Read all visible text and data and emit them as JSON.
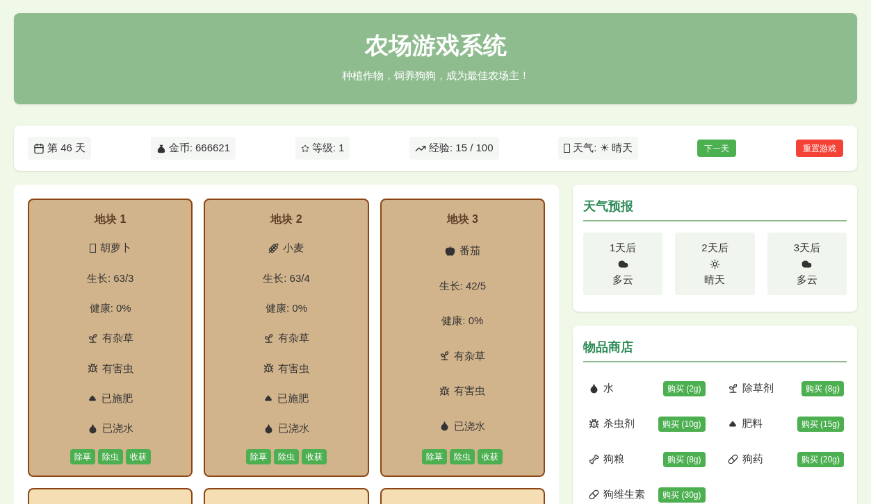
{
  "header": {
    "title": "农场游戏系统",
    "subtitle": "种植作物，饲养狗狗，成为最佳农场主！"
  },
  "stats": [
    {
      "kind": "calendar",
      "text": "第 46 天"
    },
    {
      "kind": "money",
      "text": "金币: 666621"
    },
    {
      "kind": "star",
      "text": "等级: 1"
    },
    {
      "kind": "chart",
      "text": "经验: 15 / 100"
    },
    {
      "kind": "missing",
      "text": "天气: ☀ 晴天"
    }
  ],
  "actions": [
    {
      "kind": "primary",
      "label": "下一天"
    },
    {
      "kind": "danger",
      "label": "重置游戏"
    }
  ],
  "plots": [
    {
      "title": "地块 1",
      "kind": "missing",
      "crop": "胡萝卜",
      "growth": "生长: 63/3",
      "health": "健康: 0%",
      "statuses": [
        {
          "kind": "weed",
          "text": "有杂草"
        },
        {
          "kind": "pest",
          "text": "有害虫"
        },
        {
          "kind": "fertilizer",
          "text": "已施肥"
        },
        {
          "kind": "water",
          "text": "已浇水"
        }
      ],
      "buttons": [
        "除草",
        "除虫",
        "收获"
      ]
    },
    {
      "title": "地块 2",
      "kind": "wheat",
      "crop": "小麦",
      "growth": "生长: 63/4",
      "health": "健康: 0%",
      "statuses": [
        {
          "kind": "weed",
          "text": "有杂草"
        },
        {
          "kind": "pest",
          "text": "有害虫"
        },
        {
          "kind": "fertilizer",
          "text": "已施肥"
        },
        {
          "kind": "water",
          "text": "已浇水"
        }
      ],
      "buttons": [
        "除草",
        "除虫",
        "收获"
      ]
    },
    {
      "title": "地块 3",
      "kind": "tomato",
      "crop": "番茄",
      "growth": "生长: 42/5",
      "health": "健康: 0%",
      "statuses": [
        {
          "kind": "weed",
          "text": "有杂草"
        },
        {
          "kind": "pest",
          "text": "有害虫"
        },
        {
          "kind": "water",
          "text": "已浇水"
        }
      ],
      "buttons": [
        "除草",
        "除虫",
        "收获"
      ]
    }
  ],
  "forecast": {
    "title": "天气预报",
    "days": [
      {
        "day": "1天后",
        "kind": "cloud",
        "text": "多云"
      },
      {
        "day": "2天后",
        "kind": "sun",
        "text": "晴天"
      },
      {
        "day": "3天后",
        "kind": "cloud",
        "text": "多云"
      }
    ]
  },
  "shop": {
    "title": "物品商店",
    "items": [
      {
        "kind": "water",
        "name": "水",
        "button": "购买 (2g)"
      },
      {
        "kind": "weed",
        "name": "除草剂",
        "button": "购买 (8g)"
      },
      {
        "kind": "pest",
        "name": "杀虫剂",
        "button": "购买 (10g)"
      },
      {
        "kind": "fertilizer",
        "name": "肥料",
        "button": "购买 (15g)"
      },
      {
        "kind": "bone",
        "name": "狗粮",
        "button": "购买 (8g)"
      },
      {
        "kind": "pill",
        "name": "狗药",
        "button": "购买 (20g)"
      },
      {
        "kind": "pill",
        "name": "狗维生素",
        "button": "购买 (30g)"
      }
    ]
  }
}
